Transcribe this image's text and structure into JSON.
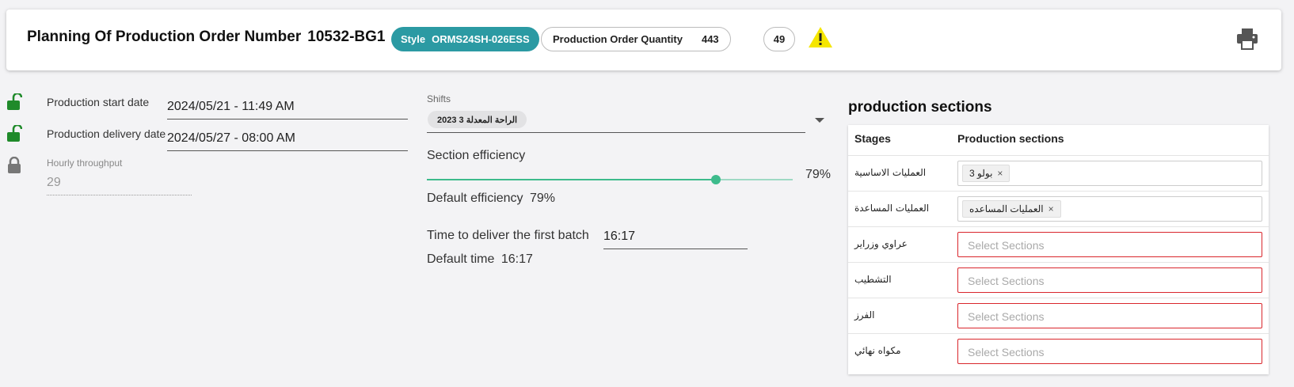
{
  "header": {
    "title": "Planning Of Production Order Number",
    "order_number": "10532-BG1",
    "style_label": "Style",
    "style_value": "ORMS24SH-026ESS",
    "qty_label": "Production Order Quantity",
    "qty_value": "443",
    "count": "49",
    "warning_icon": "warning-triangle-icon",
    "print_icon": "printer-icon",
    "colors": {
      "style_chip": "#2b9aa3",
      "warning": "#f5e600"
    }
  },
  "left": {
    "start_label": "Production start date",
    "start_value": "2024/05/21 - 11:49 AM",
    "delivery_label": "Production delivery date",
    "delivery_value": "2024/05/27 - 08:00 AM",
    "throughput_label": "Hourly throughput",
    "throughput_value": "29",
    "lock_icons": [
      "unlock-icon",
      "unlock-icon",
      "lock-icon"
    ]
  },
  "middle": {
    "shifts_label": "Shifts",
    "shift_chip": "الراحة المعدلة 3 2023",
    "efficiency_label": "Section efficiency",
    "efficiency_value": "79%",
    "efficiency_fraction": 0.79,
    "default_efficiency_label": "Default efficiency",
    "default_efficiency_value": "79%",
    "batch_label": "Time to deliver the first batch",
    "batch_value": "16:17",
    "default_time_label": "Default time",
    "default_time_value": "16:17"
  },
  "sections": {
    "title": "production sections",
    "col_stages": "Stages",
    "col_sections": "Production sections",
    "placeholder": "Select Sections",
    "rows": [
      {
        "stage": "العمليات الاساسية",
        "tag": "بولو 3"
      },
      {
        "stage": "العمليات المساعدة",
        "tag": "العمليات المساعده"
      },
      {
        "stage": "عراوي وزراير",
        "tag": null
      },
      {
        "stage": "التشطيب",
        "tag": null
      },
      {
        "stage": "الفرز",
        "tag": null
      },
      {
        "stage": "مكواه نهائي",
        "tag": null
      }
    ]
  }
}
